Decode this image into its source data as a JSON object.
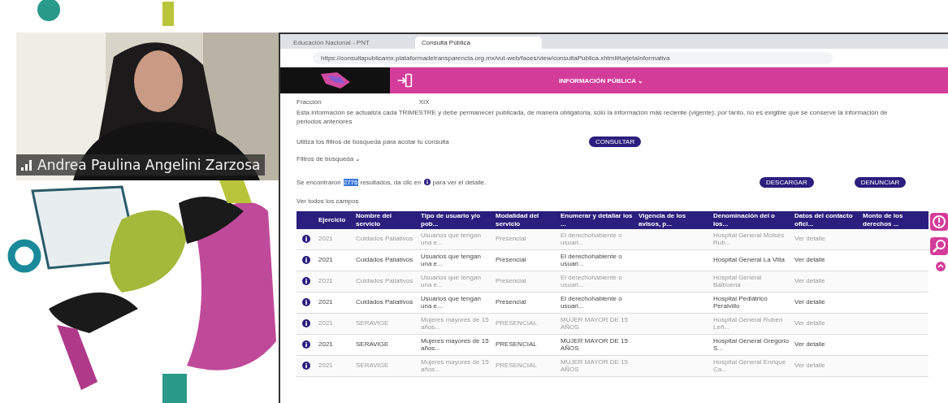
{
  "participant": {
    "name": "Andrea Paulina Angelini Zarzosa"
  },
  "browser": {
    "tabs": [
      {
        "label": "Educación Nacional - PNT",
        "selected": false
      },
      {
        "label": "Consulta Pública",
        "selected": true
      }
    ],
    "url": "https://consultapublicamx.plataformadetransparencia.org.mx/vut-web/faces/view/consultaPublica.xhtml#tarjetaInformativa"
  },
  "header": {
    "title": "INFORMACIÓN PÚBLICA ⌄"
  },
  "fraccion": {
    "label": "Fracción",
    "value": "XIX"
  },
  "notice": "Esta información se actualiza cada TRIMESTRE y debe permanecer publicada, de manera obligatoria, sólo la información más reciente (vigente); por tanto, no es exigible que se conserve la información de periodos anteriores",
  "filter_hint": "Utiliza los filtros de búsqueda para acotar tu consulta",
  "consult_button": "CONSULTAR",
  "filters_toggle": "Filtros de búsqueda ⌄",
  "results": {
    "before": "Se encontraron",
    "count": "2776",
    "after": "resultados, da clic en",
    "tail": "para ver el detalle."
  },
  "download_button": "DESCARGAR",
  "report_button": "DENUNCIAR",
  "all_fields_link": "Ver todos los campos",
  "table": {
    "columns": [
      "Ejercicio",
      "Nombre del servicio",
      "Tipo de usuario y/o pob...",
      "Modalidad del servicio",
      "Enumerar y detallar los ...",
      "Vigencia de los avisos, p...",
      "Denominación del o los...",
      "Datos del contacto ofici...",
      "Monto de los derechos ..."
    ],
    "rows": [
      {
        "faded": true,
        "cells": [
          "2021",
          "Cuidados Paliativos",
          "Usuarios que tengan una e...",
          "Presencial",
          "El derechohabiente o usuari...",
          "",
          "Hospital General Moisés Rub...",
          "Ver detalle",
          ""
        ]
      },
      {
        "faded": false,
        "cells": [
          "2021",
          "Cuidados Paliativos",
          "Usuarios que tengan una e...",
          "Presencial",
          "El derechohabiente o usuari...",
          "",
          "Hospital General La Villa",
          "Ver detalle",
          ""
        ]
      },
      {
        "faded": true,
        "cells": [
          "2021",
          "Cuidados Paliativos",
          "Usuarios que tengan una e...",
          "Presencial",
          "El derechohabiente o usuari...",
          "",
          "Hospital General Balbuena",
          "Ver detalle",
          ""
        ]
      },
      {
        "faded": false,
        "cells": [
          "2021",
          "Cuidados Paliativos",
          "Usuarios que tengan una e...",
          "Presencial",
          "El derechohabiente o usuari...",
          "",
          "Hospital Pediátrico Peralvillo",
          "Ver detalle",
          ""
        ]
      },
      {
        "faded": true,
        "cells": [
          "2021",
          "SERAVIGE",
          "Mujeres mayores de 15 años...",
          "PRESENCIAL",
          "MUJER MAYOR DE 15 AÑOS",
          "",
          "Hospital General Rubén Leñ...",
          "Ver detalle",
          ""
        ]
      },
      {
        "faded": false,
        "cells": [
          "2021",
          "SERAVIGE",
          "Mujeres mayores de 15 años...",
          "PRESENCIAL",
          "MUJER MAYOR DE 15 AÑOS",
          "",
          "Hospital General Gregorio S...",
          "Ver detalle",
          ""
        ]
      },
      {
        "faded": true,
        "cells": [
          "2021",
          "SERAVIGE",
          "Mujeres mayores de 15 años...",
          "PRESENCIAL",
          "MUJER MAYOR DE 15 AÑOS",
          "",
          "Hospital General Enrique Ca...",
          "Ver detalle",
          ""
        ]
      }
    ]
  }
}
